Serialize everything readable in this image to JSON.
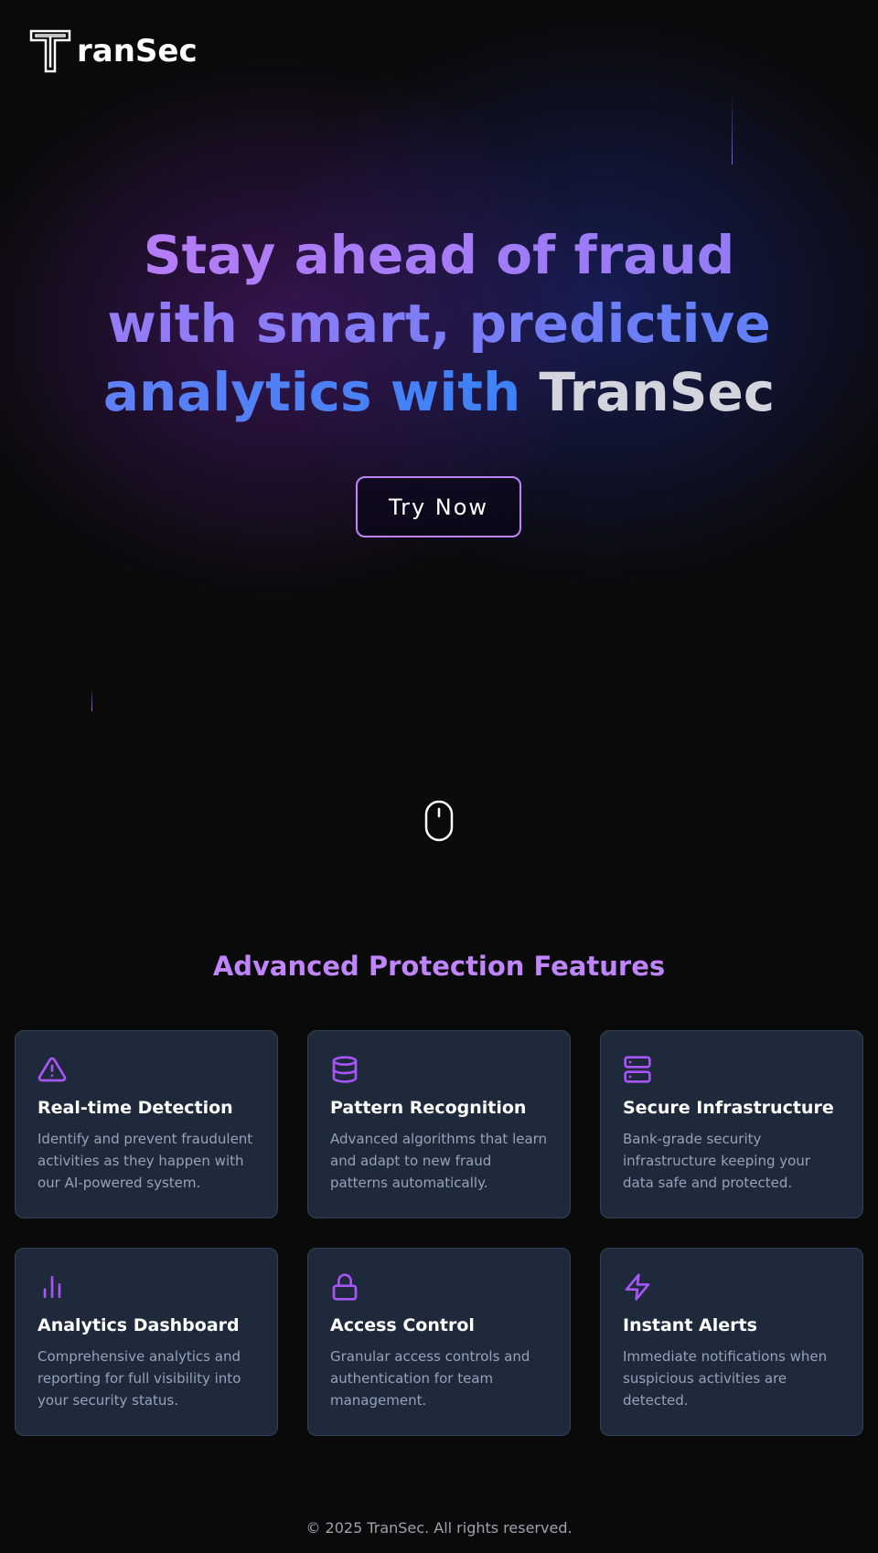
{
  "brand": {
    "logo_letter": "T",
    "name_rest": "ranSec"
  },
  "hero": {
    "headline_gradient": "Stay ahead of fraud with smart, predictive analytics with",
    "headline_brand": "TranSec",
    "cta_label": "Try Now"
  },
  "features": {
    "title": "Advanced Protection Features",
    "items": [
      {
        "icon": "alert-triangle-icon",
        "title": "Real-time Detection",
        "description": "Identify and prevent fraudulent activities as they happen with our AI-powered system."
      },
      {
        "icon": "database-icon",
        "title": "Pattern Recognition",
        "description": "Advanced algorithms that learn and adapt to new fraud patterns automatically."
      },
      {
        "icon": "server-icon",
        "title": "Secure Infrastructure",
        "description": "Bank-grade security infrastructure keeping your data safe and protected."
      },
      {
        "icon": "bar-chart-icon",
        "title": "Analytics Dashboard",
        "description": "Comprehensive analytics and reporting for full visibility into your security status."
      },
      {
        "icon": "lock-icon",
        "title": "Access Control",
        "description": "Granular access controls and authentication for team management."
      },
      {
        "icon": "zap-icon",
        "title": "Instant Alerts",
        "description": "Immediate notifications when suspicious activities are detected."
      }
    ]
  },
  "footer": {
    "copyright": "© 2025 TranSec. All rights reserved."
  },
  "colors": {
    "background": "#0a0a0a",
    "accent_purple": "#c084fc",
    "accent_blue": "#3b82f6",
    "card_bg": "#1e293b",
    "card_text": "#94a3b8"
  }
}
